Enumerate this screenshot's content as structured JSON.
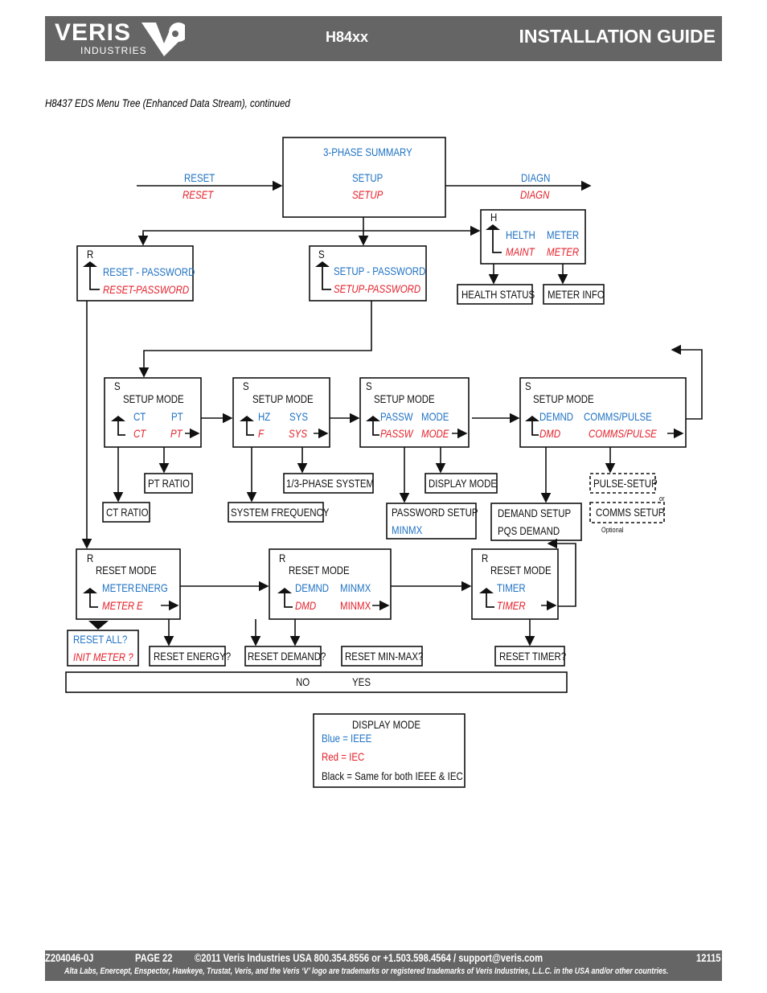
{
  "header": {
    "logo": "VERIS",
    "logo_sub": "INDUSTRIES",
    "model": "H84xx",
    "title": "INSTALLATION GUIDE"
  },
  "caption": "H8437 EDS Menu Tree (Enhanced Data Stream), continued",
  "colors": {
    "ieee_blue": "#1f72c3",
    "iec_red": "#e4202a",
    "header_gray": "#666565"
  },
  "top": {
    "reset_blue": "RESET",
    "reset_red": "RESET",
    "summary": "3-PHASE SUMMARY",
    "setup_blue": "SETUP",
    "setup_red": "SETUP",
    "diagn_blue": "DIAGN",
    "diagn_red": "DIAGN"
  },
  "health": {
    "letter": "H",
    "b1": "HELTH",
    "b2": "METER",
    "r1": "MAINT",
    "r2": "METER",
    "status": "HEALTH STATUS",
    "meter_info": "METER INFO"
  },
  "reset_pw": {
    "letter": "R",
    "blue": "RESET - PASSWORD",
    "red": "RESET-PASSWORD"
  },
  "setup_pw": {
    "letter": "S",
    "blue": "SETUP - PASSWORD",
    "red": "SETUP-PASSWORD"
  },
  "setup_boxes": [
    {
      "letter": "S",
      "title": "SETUP MODE",
      "b1": "CT",
      "b2": "PT",
      "r1": "CT",
      "r2": "PT"
    },
    {
      "letter": "S",
      "title": "SETUP MODE",
      "b1": "HZ",
      "b2": "SYS",
      "r1": "F",
      "r2": "SYS"
    },
    {
      "letter": "S",
      "title": "SETUP MODE",
      "b1": "PASSW",
      "b2": "MODE",
      "r1": "PASSW",
      "r2": "MODE"
    },
    {
      "letter": "S",
      "title": "SETUP MODE",
      "b1": "DEMND",
      "b2": "COMMS/PULSE",
      "r1": "DMD",
      "r2": "COMMS/PULSE"
    }
  ],
  "setup_sub": {
    "pt_ratio": "PT RATIO",
    "ct_ratio": "CT RATIO",
    "sys_freq": "SYSTEM FREQUENCY",
    "phase_sys": "1/3-PHASE SYSTEM",
    "display_mode": "DISPLAY MODE",
    "password_setup": "PASSWORD SETUP",
    "minmx": "MINMX",
    "demand_setup": "DEMAND SETUP",
    "pqs_demand": "PQS DEMAND",
    "pulse_setup": "PULSE-SETUP",
    "or": "or",
    "comms_setup": "COMMS SETUP",
    "optional": "Optional"
  },
  "reset_boxes": [
    {
      "letter": "R",
      "title": "RESET MODE",
      "b1": "METER",
      "b2": "ENERG",
      "r1": "METER",
      "r2": "E"
    },
    {
      "letter": "R",
      "title": "RESET MODE",
      "b1": "DEMND",
      "b2": "MINMX",
      "r1": "DMD",
      "r2": "MINMX"
    },
    {
      "letter": "R",
      "title": "RESET MODE",
      "b1": "TIMER",
      "r1": "TIMER"
    }
  ],
  "reset_sub": {
    "all_blue": "RESET ALL?",
    "all_red": "INIT METER ?",
    "energy": "RESET ENERGY?",
    "demand": "RESET DEMAND?",
    "minmax": "RESET MIN-MAX?",
    "timer": "RESET TIMER?"
  },
  "no": "NO",
  "yes": "YES",
  "legend": {
    "title": "DISPLAY MODE",
    "blue": "Blue = IEEE",
    "red": "Red = IEC",
    "black": "Black = Same for both IEEE & IEC"
  },
  "footer": {
    "doc": "Z204046-0J",
    "page": "PAGE 22",
    "contact": "©2011 Veris Industries   USA 800.354.8556 or +1.503.598.4564  / support@veris.com",
    "code": "12115",
    "trademark": "Alta Labs, Enercept, Enspector, Hawkeye, Trustat, Veris, and the Veris ‘V’ logo are trademarks or registered trademarks of  Veris Industries, L.L.C. in the USA and/or other countries."
  }
}
